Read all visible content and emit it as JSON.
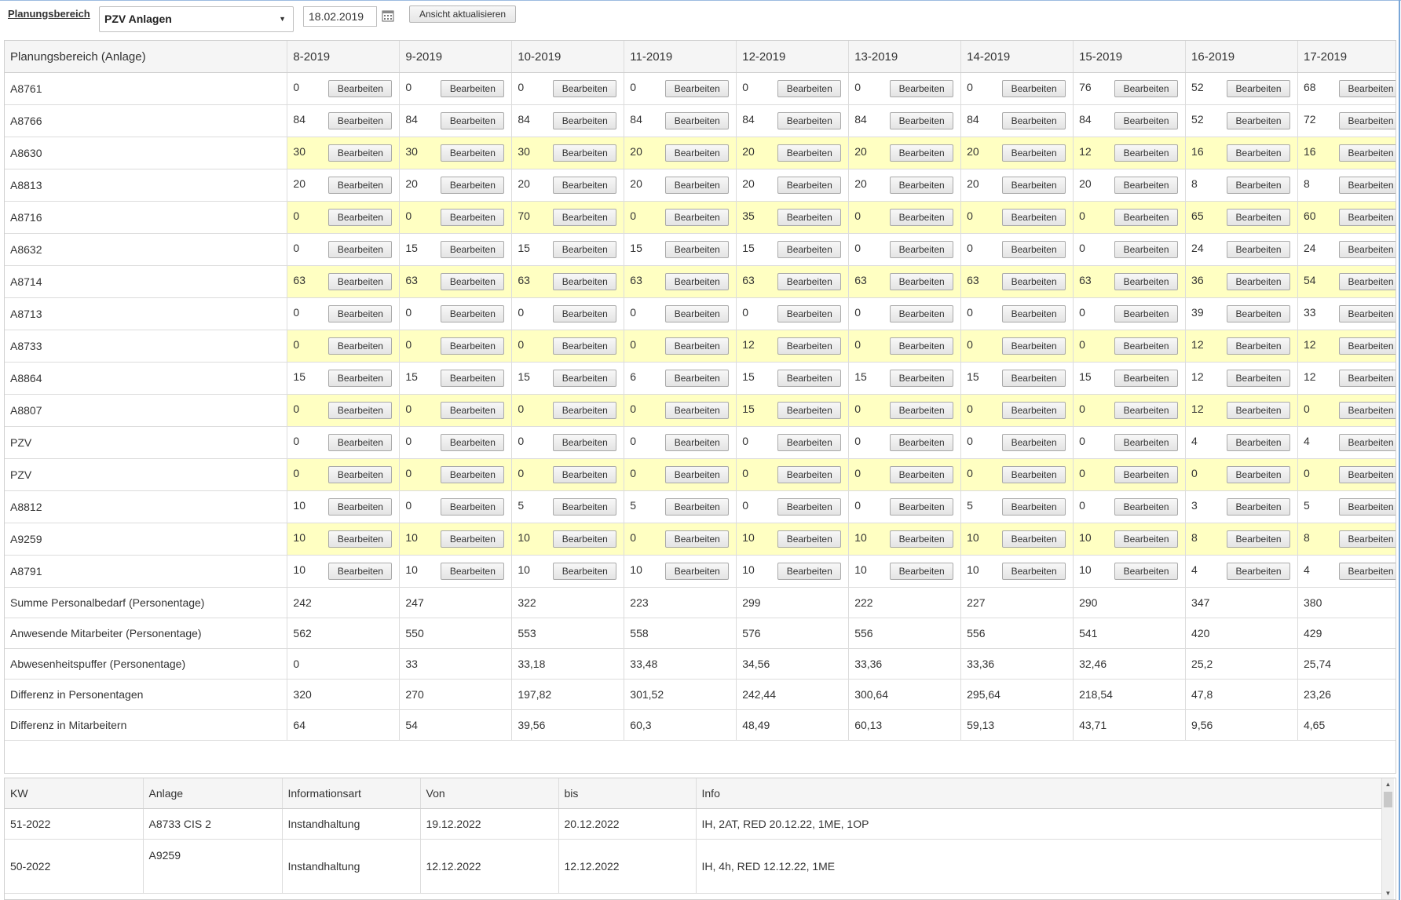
{
  "toolbar": {
    "planungsbereich_label": "Planungsbereich",
    "select_value": "PZV Anlagen",
    "date_value": "18.02.2019",
    "refresh_label": "Ansicht aktualisieren",
    "calendar_icon": "calendar-icon"
  },
  "grid": {
    "first_header": "Planungsbereich (Anlage)",
    "weeks": [
      "8-2019",
      "9-2019",
      "10-2019",
      "11-2019",
      "12-2019",
      "13-2019",
      "14-2019",
      "15-2019",
      "16-2019",
      "17-2019"
    ],
    "edit_label": "Bearbeiten",
    "rows": [
      {
        "name": "A8761",
        "hl": false,
        "values": [
          "0",
          "0",
          "0",
          "0",
          "0",
          "0",
          "0",
          "76",
          "52",
          "68"
        ]
      },
      {
        "name": "A8766",
        "hl": false,
        "values": [
          "84",
          "84",
          "84",
          "84",
          "84",
          "84",
          "84",
          "84",
          "52",
          "72"
        ]
      },
      {
        "name": "A8630",
        "hl": true,
        "values": [
          "30",
          "30",
          "30",
          "20",
          "20",
          "20",
          "20",
          "12",
          "16",
          "16"
        ]
      },
      {
        "name": "A8813",
        "hl": false,
        "values": [
          "20",
          "20",
          "20",
          "20",
          "20",
          "20",
          "20",
          "20",
          "8",
          "8"
        ]
      },
      {
        "name": "A8716",
        "hl": true,
        "values": [
          "0",
          "0",
          "70",
          "0",
          "35",
          "0",
          "0",
          "0",
          "65",
          "60"
        ]
      },
      {
        "name": "A8632",
        "hl": false,
        "values": [
          "0",
          "15",
          "15",
          "15",
          "15",
          "0",
          "0",
          "0",
          "24",
          "24"
        ]
      },
      {
        "name": "A8714",
        "hl": true,
        "values": [
          "63",
          "63",
          "63",
          "63",
          "63",
          "63",
          "63",
          "63",
          "36",
          "54"
        ]
      },
      {
        "name": "A8713",
        "hl": false,
        "values": [
          "0",
          "0",
          "0",
          "0",
          "0",
          "0",
          "0",
          "0",
          "39",
          "33"
        ]
      },
      {
        "name": "A8733",
        "hl": true,
        "values": [
          "0",
          "0",
          "0",
          "0",
          "12",
          "0",
          "0",
          "0",
          "12",
          "12"
        ]
      },
      {
        "name": "A8864",
        "hl": false,
        "values": [
          "15",
          "15",
          "15",
          "6",
          "15",
          "15",
          "15",
          "15",
          "12",
          "12"
        ]
      },
      {
        "name": "A8807",
        "hl": true,
        "values": [
          "0",
          "0",
          "0",
          "0",
          "15",
          "0",
          "0",
          "0",
          "12",
          "0"
        ]
      },
      {
        "name": "PZV",
        "hl": false,
        "values": [
          "0",
          "0",
          "0",
          "0",
          "0",
          "0",
          "0",
          "0",
          "4",
          "4"
        ]
      },
      {
        "name": "PZV",
        "hl": true,
        "values": [
          "0",
          "0",
          "0",
          "0",
          "0",
          "0",
          "0",
          "0",
          "0",
          "0"
        ]
      },
      {
        "name": "A8812",
        "hl": false,
        "values": [
          "10",
          "0",
          "5",
          "5",
          "0",
          "0",
          "5",
          "0",
          "3",
          "5"
        ]
      },
      {
        "name": "A9259",
        "hl": true,
        "values": [
          "10",
          "10",
          "10",
          "0",
          "10",
          "10",
          "10",
          "10",
          "8",
          "8"
        ]
      },
      {
        "name": "A8791",
        "hl": false,
        "values": [
          "10",
          "10",
          "10",
          "10",
          "10",
          "10",
          "10",
          "10",
          "4",
          "4"
        ]
      }
    ],
    "summary": [
      {
        "name": "Summe Personalbedarf (Personentage)",
        "values": [
          "242",
          "247",
          "322",
          "223",
          "299",
          "222",
          "227",
          "290",
          "347",
          "380"
        ]
      },
      {
        "name": "Anwesende Mitarbeiter (Personentage)",
        "values": [
          "562",
          "550",
          "553",
          "558",
          "576",
          "556",
          "556",
          "541",
          "420",
          "429"
        ]
      },
      {
        "name": "Abwesenheitspuffer (Personentage)",
        "values": [
          "0",
          "33",
          "33,18",
          "33,48",
          "34,56",
          "33,36",
          "33,36",
          "32,46",
          "25,2",
          "25,74"
        ]
      },
      {
        "name": "Differenz in Personentagen",
        "values": [
          "320",
          "270",
          "197,82",
          "301,52",
          "242,44",
          "300,64",
          "295,64",
          "218,54",
          "47,8",
          "23,26"
        ]
      },
      {
        "name": "Differenz in Mitarbeitern",
        "values": [
          "64",
          "54",
          "39,56",
          "60,3",
          "48,49",
          "60,13",
          "59,13",
          "43,71",
          "9,56",
          "4,65"
        ]
      }
    ]
  },
  "info": {
    "headers": [
      "KW",
      "Anlage",
      "Informationsart",
      "Von",
      "bis",
      "Info"
    ],
    "rows": [
      [
        "51-2022",
        "A8733 CIS 2",
        "Instandhaltung",
        "19.12.2022",
        "20.12.2022",
        "IH, 2AT, RED 20.12.22, 1ME, 1OP"
      ],
      [
        "50-2022",
        "A9259",
        "Instandhaltung",
        "12.12.2022",
        "12.12.2022",
        "IH, 4h, RED 12.12.22, 1ME"
      ]
    ]
  },
  "colors": {
    "highlight_row": "#ffffc2",
    "header_bg": "#f5f5f5",
    "border": "#dcdcdc"
  }
}
